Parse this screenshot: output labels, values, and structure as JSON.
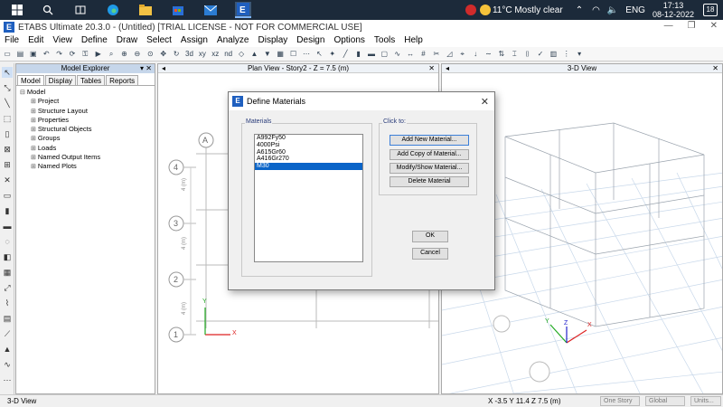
{
  "taskbar": {
    "icons": [
      "windows-logo",
      "search",
      "task-view",
      "edge",
      "file-explorer",
      "store",
      "mail",
      "etabs"
    ],
    "weather": "11°C  Mostly clear",
    "lang": "ENG",
    "time": "17:13",
    "date": "08-12-2022",
    "notif_count": "18"
  },
  "window": {
    "title": "ETABS Ultimate 20.3.0 - (Untitled)  [TRIAL LICENSE - NOT FOR COMMERCIAL USE]"
  },
  "menu": [
    "File",
    "Edit",
    "View",
    "Define",
    "Draw",
    "Select",
    "Assign",
    "Analyze",
    "Display",
    "Design",
    "Options",
    "Tools",
    "Help"
  ],
  "explorer": {
    "title": "Model Explorer",
    "tabs": [
      "Model",
      "Display",
      "Tables",
      "Reports"
    ],
    "root": "Model",
    "items": [
      "Project",
      "Structure Layout",
      "Properties",
      "Structural Objects",
      "Groups",
      "Loads",
      "Named Output Items",
      "Named Plots"
    ]
  },
  "planview": {
    "title": "Plan View - Story2 - Z = 7.5 (m)",
    "col_bubble": "A",
    "row_bubbles": [
      "4",
      "3",
      "2",
      "1"
    ],
    "dim_label": "4 (m)",
    "axis_x": "X",
    "axis_y": "Y"
  },
  "view3d": {
    "title": "3-D View",
    "axis_x": "X",
    "axis_y": "Y",
    "axis_z": "Z"
  },
  "dialog": {
    "title": "Define Materials",
    "materials_label": "Materials",
    "materials": [
      "A992Fy50",
      "4000Psi",
      "A615Gr60",
      "A416Gr270",
      "M30"
    ],
    "selected": "M30",
    "click_to_label": "Click to:",
    "add_new": "Add New Material...",
    "add_copy": "Add Copy of Material...",
    "modify_show": "Modify/Show Material...",
    "delete": "Delete Material",
    "ok": "OK",
    "cancel": "Cancel"
  },
  "status": {
    "view": "3-D View",
    "coords": "X -3.5  Y 11.4  Z 7.5 (m)",
    "story": "One Story",
    "coord_sys": "Global",
    "units": "Units..."
  }
}
